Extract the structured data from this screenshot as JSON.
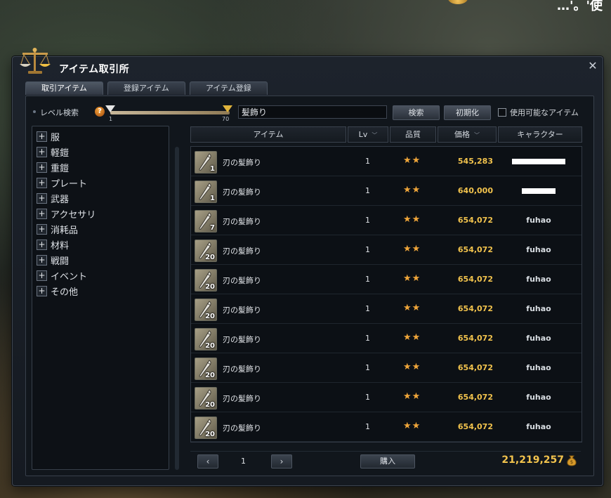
{
  "game_hud": {
    "top_right_text": "…'。'使"
  },
  "window": {
    "title": "アイテム取引所",
    "close_symbol": "✕"
  },
  "tabs": [
    {
      "label": "取引アイテム",
      "active": true
    },
    {
      "label": "登録アイテム",
      "active": false
    },
    {
      "label": "アイテム登録",
      "active": false
    }
  ],
  "level_search": {
    "label": "レベル検索",
    "min_label": "1",
    "max_label": "70",
    "help_symbol": "?"
  },
  "search": {
    "value": "髪飾り",
    "search_button": "検索",
    "reset_button": "初期化",
    "usable_only_label": "使用可能なアイテム",
    "usable_only_checked": false
  },
  "categories": [
    {
      "label": "服"
    },
    {
      "label": "軽鎧"
    },
    {
      "label": "重鎧"
    },
    {
      "label": "プレート"
    },
    {
      "label": "武器"
    },
    {
      "label": "アクセサリ"
    },
    {
      "label": "消耗品"
    },
    {
      "label": "材料"
    },
    {
      "label": "戦闘"
    },
    {
      "label": "イベント"
    },
    {
      "label": "その他"
    }
  ],
  "columns": {
    "item": "アイテム",
    "lv": "Lv",
    "quality": "品質",
    "price": "価格",
    "character": "キャラクター"
  },
  "listings": [
    {
      "qty": "1",
      "name": "刃の髪飾り",
      "lv": "1",
      "quality": "★★",
      "price": "545,283",
      "character": "",
      "character_redacted": true
    },
    {
      "qty": "1",
      "name": "刃の髪飾り",
      "lv": "1",
      "quality": "★★",
      "price": "640,000",
      "character": "",
      "character_redacted": true
    },
    {
      "qty": "7",
      "name": "刃の髪飾り",
      "lv": "1",
      "quality": "★★",
      "price": "654,072",
      "character": "fuhao"
    },
    {
      "qty": "20",
      "name": "刃の髪飾り",
      "lv": "1",
      "quality": "★★",
      "price": "654,072",
      "character": "fuhao"
    },
    {
      "qty": "20",
      "name": "刃の髪飾り",
      "lv": "1",
      "quality": "★★",
      "price": "654,072",
      "character": "fuhao"
    },
    {
      "qty": "20",
      "name": "刃の髪飾り",
      "lv": "1",
      "quality": "★★",
      "price": "654,072",
      "character": "fuhao"
    },
    {
      "qty": "20",
      "name": "刃の髪飾り",
      "lv": "1",
      "quality": "★★",
      "price": "654,072",
      "character": "fuhao"
    },
    {
      "qty": "20",
      "name": "刃の髪飾り",
      "lv": "1",
      "quality": "★★",
      "price": "654,072",
      "character": "fuhao"
    },
    {
      "qty": "20",
      "name": "刃の髪飾り",
      "lv": "1",
      "quality": "★★",
      "price": "654,072",
      "character": "fuhao"
    },
    {
      "qty": "20",
      "name": "刃の髪飾り",
      "lv": "1",
      "quality": "★★",
      "price": "654,072",
      "character": "fuhao"
    }
  ],
  "pager": {
    "prev_symbol": "‹",
    "next_symbol": "›",
    "page": "1",
    "buy_button": "購入",
    "money": "21,219,257"
  },
  "colors": {
    "price": "#f2c34d",
    "stars": "#f0a63a",
    "window_bg": "#1d232c"
  }
}
